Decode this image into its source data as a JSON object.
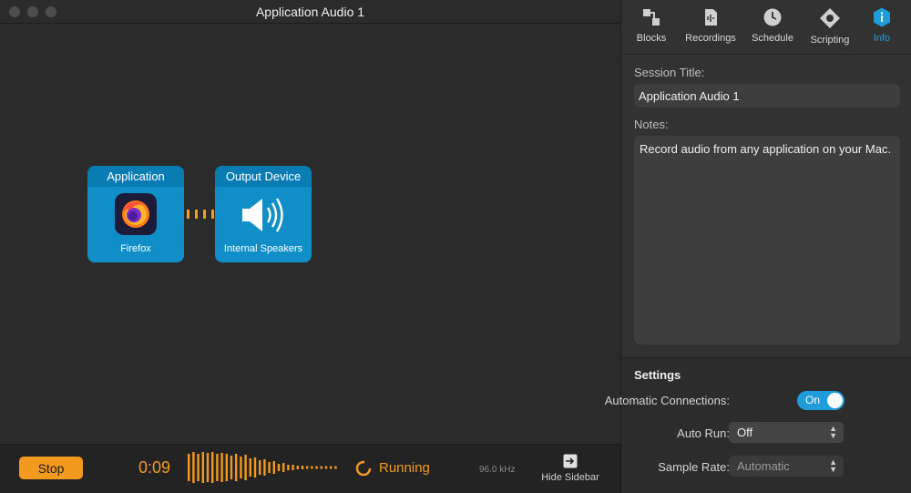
{
  "window": {
    "title": "Application Audio 1"
  },
  "blocks": {
    "application": {
      "header": "Application",
      "caption": "Firefox"
    },
    "output": {
      "header": "Output Device",
      "caption": "Internal Speakers"
    }
  },
  "bottom_bar": {
    "stop_label": "Stop",
    "elapsed": "0:09",
    "status": "Running",
    "sample_rate": "96.0 kHz",
    "hide_sidebar_label": "Hide Sidebar"
  },
  "toolbar": {
    "items": [
      {
        "label": "Blocks",
        "icon": "blocks-icon"
      },
      {
        "label": "Recordings",
        "icon": "recordings-icon"
      },
      {
        "label": "Schedule",
        "icon": "clock-icon"
      },
      {
        "label": "Scripting",
        "icon": "scripting-icon"
      },
      {
        "label": "Info",
        "icon": "info-icon",
        "active": true
      }
    ]
  },
  "info": {
    "session_title_label": "Session Title:",
    "session_title": "Application Audio 1",
    "notes_label": "Notes:",
    "notes": "Record audio from any application on your Mac."
  },
  "settings": {
    "title": "Settings",
    "automatic_connections_label": "Automatic Connections:",
    "automatic_connections": "On",
    "auto_run_label": "Auto Run:",
    "auto_run": "Off",
    "sample_rate_label": "Sample Rate:",
    "sample_rate": "Automatic"
  },
  "colors": {
    "accent_orange": "#f29a1e",
    "accent_blue": "#1e9cdc",
    "block_blue": "#0f8ec8"
  }
}
